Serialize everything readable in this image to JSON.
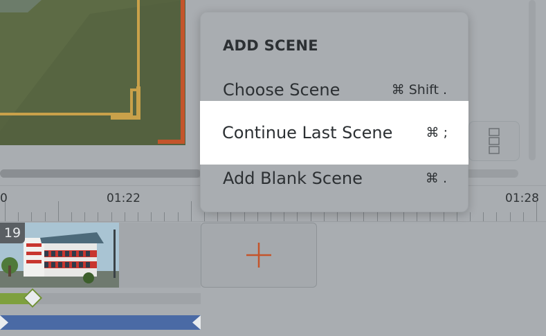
{
  "menu": {
    "header": "ADD SCENE",
    "items": [
      {
        "label": "Choose Scene",
        "shortcut": "⌘ Shift ."
      },
      {
        "label": "Continue Last Scene",
        "shortcut": "⌘ ;"
      },
      {
        "label": "Add Blank Scene",
        "shortcut": "⌘ ."
      }
    ]
  },
  "ruler": {
    "labels": [
      "0",
      "01:22",
      "01:28"
    ]
  },
  "timeline": {
    "scene_number": "19"
  },
  "icons": {
    "add_scene": "plus-icon",
    "layout": "grid-icon"
  },
  "colors": {
    "highlight_bg": "#ffffff",
    "add_plus": "#c4542a",
    "track_green": "#7ea03e",
    "track_blue": "#4a6aa5"
  }
}
